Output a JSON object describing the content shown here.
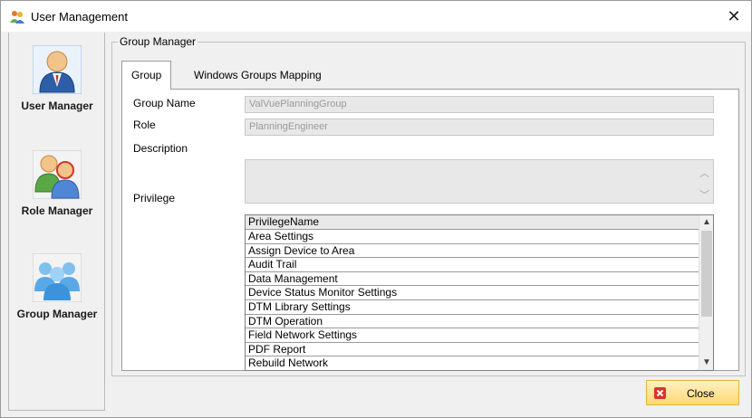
{
  "window": {
    "title": "User Management",
    "close_glyph": "✕"
  },
  "sidebar": {
    "items": [
      {
        "label": "User Manager",
        "icon": "user-manager-icon"
      },
      {
        "label": "Role Manager",
        "icon": "role-manager-icon"
      },
      {
        "label": "Group Manager",
        "icon": "group-manager-icon"
      }
    ]
  },
  "main": {
    "groupbox_title": "Group Manager",
    "tabs": [
      {
        "label": "Group",
        "active": true
      },
      {
        "label": "Windows Groups Mapping",
        "active": false
      }
    ],
    "fields": {
      "group_name": {
        "label": "Group Name",
        "value": "ValVuePlanningGroup"
      },
      "role": {
        "label": "Role",
        "value": "PlanningEngineer"
      },
      "description": {
        "label": "Description",
        "value": ""
      },
      "privilege": {
        "label": "Privilege"
      }
    },
    "privilege_grid": {
      "header": "PrivilegeName",
      "rows": [
        "Area Settings",
        "Assign Device to Area",
        "Audit Trail",
        "Data Management",
        "Device Status Monitor Settings",
        "DTM Library Settings",
        "DTM Operation",
        "Field Network Settings",
        "PDF Report",
        "Rebuild Network"
      ]
    }
  },
  "footer": {
    "close_label": "Close"
  },
  "colors": {
    "accent_button": "#ffd873",
    "close_icon_red": "#d9342b"
  }
}
